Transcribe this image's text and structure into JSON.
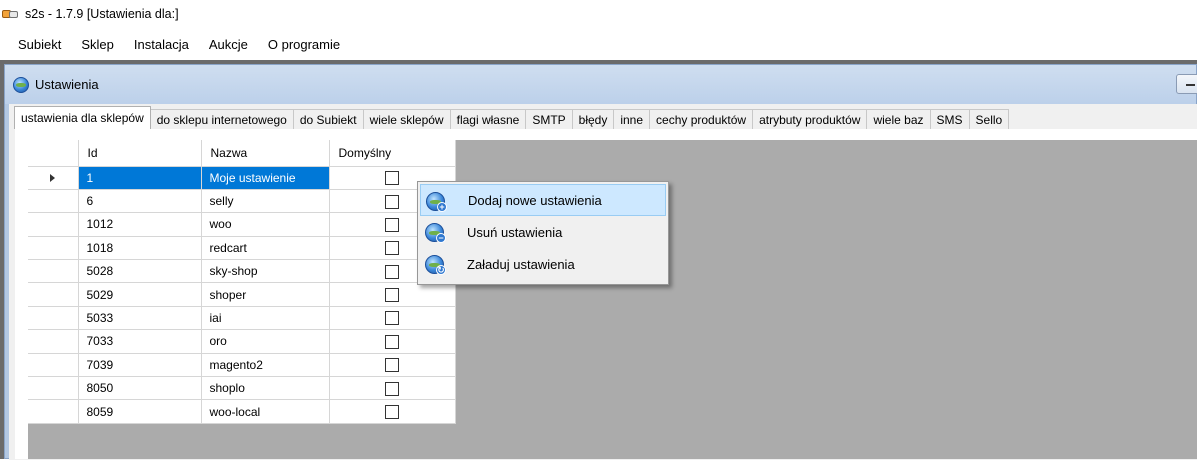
{
  "window": {
    "title": "s2s - 1.7.9 [Ustawienia dla:]"
  },
  "menu": [
    "Subiekt",
    "Sklep",
    "Instalacja",
    "Aukcje",
    "O programie"
  ],
  "child_window": {
    "title": "Ustawienia"
  },
  "tabs": [
    "ustawienia dla sklepów",
    "do sklepu internetowego",
    "do Subiekt",
    "wiele sklepów",
    "flagi własne",
    "SMTP",
    "błędy",
    "inne",
    "cechy produktów",
    "atrybuty produktów",
    "wiele baz",
    "SMS",
    "Sello"
  ],
  "active_tab": 0,
  "grid": {
    "columns": [
      "Id",
      "Nazwa",
      "Domyślny"
    ],
    "rows": [
      {
        "id": "1",
        "name": "Moje ustawienie",
        "default": false
      },
      {
        "id": "6",
        "name": "selly",
        "default": false
      },
      {
        "id": "1012",
        "name": "woo",
        "default": false
      },
      {
        "id": "1018",
        "name": "redcart",
        "default": false
      },
      {
        "id": "5028",
        "name": "sky-shop",
        "default": false
      },
      {
        "id": "5029",
        "name": "shoper",
        "default": false
      },
      {
        "id": "5033",
        "name": "iai",
        "default": false
      },
      {
        "id": "7033",
        "name": "oro",
        "default": false
      },
      {
        "id": "7039",
        "name": " magento2",
        "default": false
      },
      {
        "id": "8050",
        "name": "shoplo",
        "default": false
      },
      {
        "id": "8059",
        "name": "woo-local",
        "default": false
      }
    ],
    "selected_row": 0
  },
  "context_menu": {
    "items": [
      {
        "label": "Dodaj nowe ustawienia",
        "icon": "globe-add-icon"
      },
      {
        "label": "Usuń ustawienia",
        "icon": "globe-remove-icon"
      },
      {
        "label": "Załaduj ustawienia",
        "icon": "globe-load-icon"
      }
    ]
  }
}
